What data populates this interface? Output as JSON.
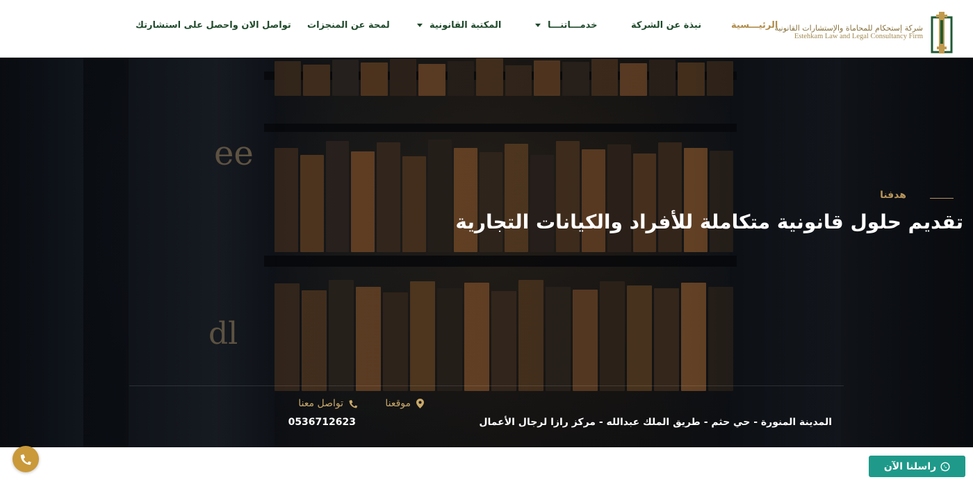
{
  "brand": {
    "name_ar": "شركة إستحكام للمحاماة والإستشارات القانونية",
    "name_en": "Estehkam Law and Legal Consultancy Firm",
    "logo_icon": "tower-logo-icon"
  },
  "nav": {
    "home": "الرئيـــسية",
    "about": "نبذة عن الشركة",
    "services": "خدمـــاتنـــا",
    "library": "المكتبة القانونية",
    "achievements": "لمحة عن المنجزات",
    "contact": "تواصل الان واحصل على استشارتك"
  },
  "hero": {
    "kicker": "هدفنا",
    "title": "تقديم حلول قانونية متكاملة للأفراد والكيانات التجارية"
  },
  "info": {
    "location_label": "موقعنا",
    "location_value": "المدينة المنورة - حي حثم - طريق الملك عبدالله - مركز رازا لرجال الأعمال",
    "contact_label": "تواصل معنا",
    "contact_value": "0536712623"
  },
  "floating": {
    "whatsapp_label": "راسلنا الآن"
  },
  "colors": {
    "gold": "#c9a96a",
    "green": "#1f4a2c",
    "whatsapp": "#1f9a8a",
    "call": "#c9993a"
  }
}
